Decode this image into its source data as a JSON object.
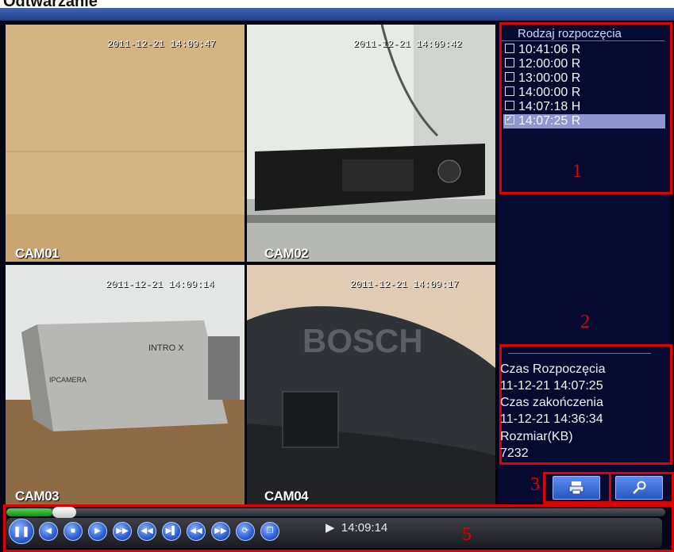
{
  "window": {
    "title": "Odtwarzanie"
  },
  "cameras": [
    {
      "timestamp": "2011-12-21 14:09:47",
      "label": "CAM01"
    },
    {
      "timestamp": "2011-12-21 14:09:42",
      "label": "CAM02"
    },
    {
      "timestamp": "2011-12-21 14:09:14",
      "label": "CAM03"
    },
    {
      "timestamp": "2011-12-21 14:09:17",
      "label": "CAM04"
    }
  ],
  "recordings": {
    "header": "Rodzaj rozpoczęcia",
    "items": [
      {
        "text": "10:41:06  R",
        "checked": false,
        "selected": false
      },
      {
        "text": "12:00:00  R",
        "checked": false,
        "selected": false
      },
      {
        "text": "13:00:00  R",
        "checked": false,
        "selected": false
      },
      {
        "text": "14:00:00  R",
        "checked": false,
        "selected": false
      },
      {
        "text": "14:07:18  H",
        "checked": false,
        "selected": false
      },
      {
        "text": "14:07:25  R",
        "checked": true,
        "selected": true
      }
    ]
  },
  "info": {
    "start_label": "Czas Rozpoczęcia",
    "start_value": "11-12-21 14:07:25",
    "end_label": "Czas zakończenia",
    "end_value": "11-12-21 14:36:34",
    "size_label": "Rozmiar(KB)",
    "size_value": "7232"
  },
  "annotations": {
    "n1": "1",
    "n2": "2",
    "n3": "3",
    "n5": "5"
  },
  "buttons": {
    "backup_icon": "printer-icon",
    "search_icon": "magnifier-icon"
  },
  "playback": {
    "progress": 0.07,
    "current_time": "14:09:14",
    "controls": [
      "pause",
      "prev",
      "stop",
      "slow",
      "fast",
      "step-back",
      "step-forward",
      "prev-file",
      "next-file",
      "repeat",
      "window"
    ]
  },
  "colors": {
    "highlight": "#e00000",
    "selected_row": "#8f95cf",
    "accent": "#2a5fd0"
  }
}
